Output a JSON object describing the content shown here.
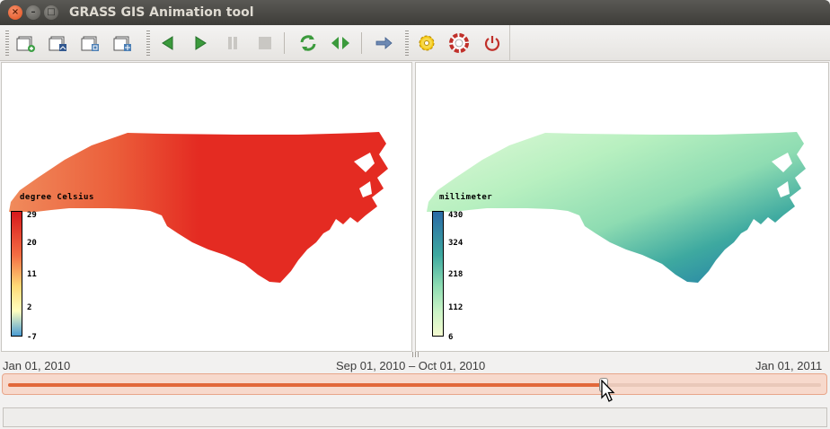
{
  "window": {
    "title": "GRASS GIS Animation tool"
  },
  "toolbar": {
    "groups": [
      {
        "buttons": [
          "add-layer-icon",
          "add-vector-icon",
          "add-raster-series-icon",
          "edit-layers-icon"
        ]
      },
      {
        "buttons": [
          "play-back-icon",
          "play-icon",
          "pause-icon",
          "stop-icon",
          "loop-icon",
          "reverse-icon",
          "next-icon"
        ]
      },
      {
        "buttons": [
          "settings-gear-icon",
          "help-lifebuoy-icon",
          "quit-power-icon"
        ]
      }
    ]
  },
  "maps": {
    "left": {
      "unit": "degree Celsius",
      "ticks": [
        "29",
        "20",
        "11",
        "2",
        "-7"
      ],
      "colors": {
        "fill": "#e42b22",
        "west": "#f08b5c"
      }
    },
    "right": {
      "unit": "millimeter",
      "ticks": [
        "430",
        "324",
        "218",
        "112",
        "6"
      ],
      "colors": {
        "west": "#c4f3c6",
        "mid": "#9ee3b6",
        "east": "#2e9a9c",
        "deep": "#2167a8"
      }
    }
  },
  "timeline": {
    "start_label": "Jan 01, 2010",
    "current_label": "Sep 01, 2010 – Oct 01, 2010",
    "end_label": "Jan 01, 2011",
    "position": 0.733
  },
  "statusbar": {
    "text": ""
  }
}
